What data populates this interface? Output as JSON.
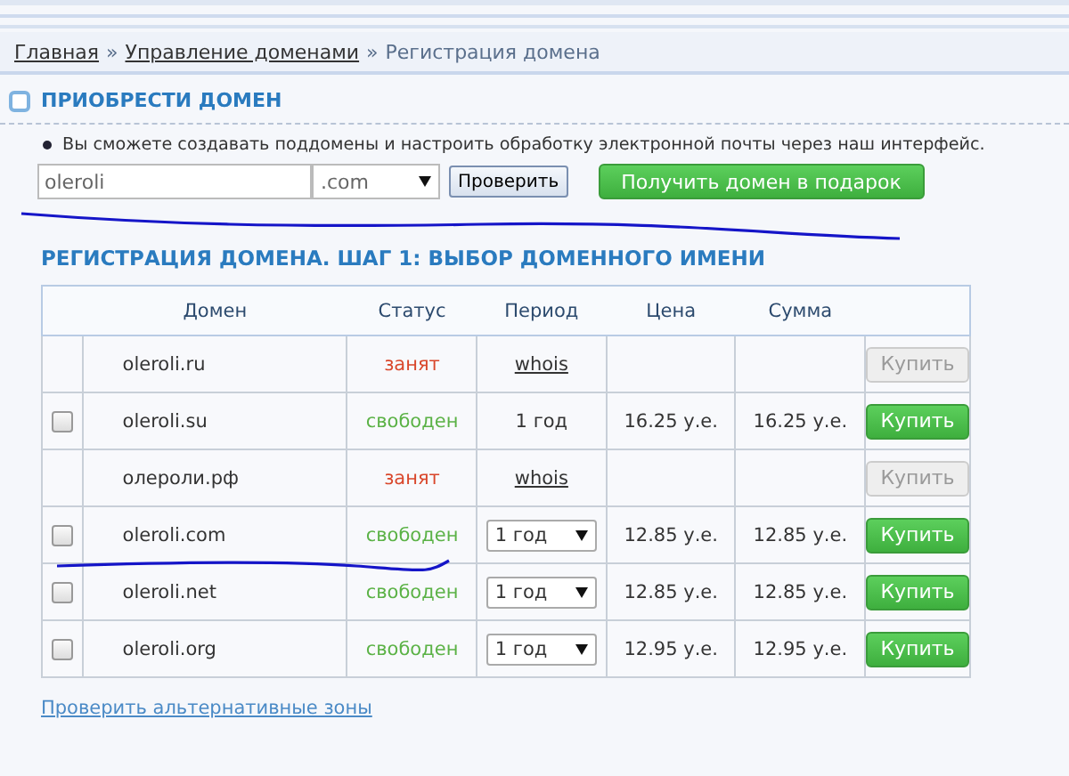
{
  "breadcrumbs": [
    {
      "label": "Главная",
      "link": true
    },
    {
      "label": "Управление доменами",
      "link": true
    },
    {
      "label": "Регистрация домена",
      "link": false
    }
  ],
  "breadcrumb_separator": "»",
  "purchase": {
    "title": "ПРИОБРЕСТИ ДОМЕН",
    "note": "Вы сможете создавать поддомены и настроить обработку электронной почты через наш интерфейс.",
    "domain_value": "oleroli",
    "zone": ".com",
    "check_button": "Проверить",
    "gift_button": "Получить домен в подарок"
  },
  "registration": {
    "title": "РЕГИСТРАЦИЯ ДОМЕНА. ШАГ 1: ВЫБОР ДОМЕННОГО ИМЕНИ",
    "columns": [
      "Домен",
      "Статус",
      "Период",
      "Цена",
      "Сумма"
    ],
    "rows": [
      {
        "checkbox": false,
        "domain": "oleroli.ru",
        "status": "занят",
        "free": false,
        "period": {
          "kind": "link",
          "value": "whois"
        },
        "price": "",
        "total": "",
        "buy": "Купить",
        "buy_disabled": true
      },
      {
        "checkbox": true,
        "checked": false,
        "domain": "oleroli.su",
        "status": "свободен",
        "free": true,
        "period": {
          "kind": "text",
          "value": "1 год"
        },
        "price": "16.25 у.е.",
        "total": "16.25 у.е.",
        "buy": "Купить",
        "buy_disabled": false
      },
      {
        "checkbox": false,
        "domain": "олероли.рф",
        "status": "занят",
        "free": false,
        "period": {
          "kind": "link",
          "value": "whois"
        },
        "price": "",
        "total": "",
        "buy": "Купить",
        "buy_disabled": true
      },
      {
        "checkbox": true,
        "checked": false,
        "domain": "oleroli.com",
        "status": "свободен",
        "free": true,
        "period": {
          "kind": "select",
          "value": "1 год"
        },
        "price": "12.85 у.е.",
        "total": "12.85 у.е.",
        "buy": "Купить",
        "buy_disabled": false
      },
      {
        "checkbox": true,
        "checked": false,
        "domain": "oleroli.net",
        "status": "свободен",
        "free": true,
        "period": {
          "kind": "select",
          "value": "1 год"
        },
        "price": "12.85 у.е.",
        "total": "12.85 у.е.",
        "buy": "Купить",
        "buy_disabled": false
      },
      {
        "checkbox": true,
        "checked": false,
        "domain": "oleroli.org",
        "status": "свободен",
        "free": true,
        "period": {
          "kind": "select",
          "value": "1 год"
        },
        "price": "12.95 у.е.",
        "total": "12.95 у.е.",
        "buy": "Купить",
        "buy_disabled": false
      }
    ],
    "alt_link": "Проверить альтернативные зоны"
  }
}
